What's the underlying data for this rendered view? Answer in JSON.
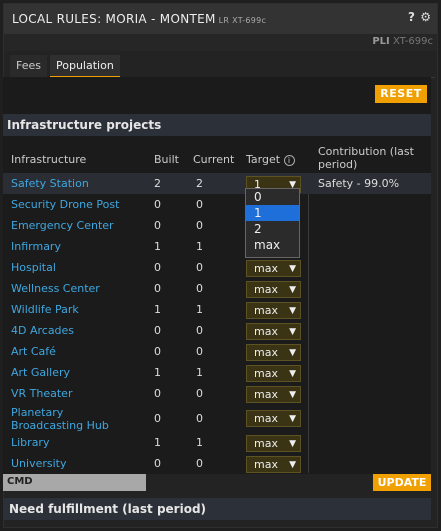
{
  "title": "LOCAL RULES: MORIA - MONTEM",
  "title_sub": "LR XT-699c",
  "context_prefix": "PLI",
  "context_code": "XT-699c",
  "tabs": [
    "Fees",
    "Population"
  ],
  "reset_label": "RESET",
  "section_title": "Infrastructure projects",
  "headers": {
    "infrastructure": "Infrastructure",
    "built": "Built",
    "current": "Current",
    "target": "Target",
    "contribution": "Contribution (last period)"
  },
  "rows": [
    {
      "name": "Safety Station",
      "built": "2",
      "current": "2",
      "target": "1",
      "contribution": "Safety - 99.0%"
    },
    {
      "name": "Security Drone Post",
      "built": "0",
      "current": "0",
      "target": "",
      "contribution": ""
    },
    {
      "name": "Emergency Center",
      "built": "0",
      "current": "0",
      "target": "",
      "contribution": ""
    },
    {
      "name": "Infirmary",
      "built": "1",
      "current": "1",
      "target": "",
      "contribution": ""
    },
    {
      "name": "Hospital",
      "built": "0",
      "current": "0",
      "target": "max",
      "contribution": ""
    },
    {
      "name": "Wellness Center",
      "built": "0",
      "current": "0",
      "target": "max",
      "contribution": ""
    },
    {
      "name": "Wildlife Park",
      "built": "1",
      "current": "1",
      "target": "max",
      "contribution": ""
    },
    {
      "name": "4D Arcades",
      "built": "0",
      "current": "0",
      "target": "max",
      "contribution": ""
    },
    {
      "name": "Art Café",
      "built": "0",
      "current": "0",
      "target": "max",
      "contribution": ""
    },
    {
      "name": "Art Gallery",
      "built": "1",
      "current": "1",
      "target": "max",
      "contribution": ""
    },
    {
      "name": "VR Theater",
      "built": "0",
      "current": "0",
      "target": "max",
      "contribution": ""
    },
    {
      "name": "Planetary Broadcasting Hub",
      "built": "0",
      "current": "0",
      "target": "max",
      "contribution": ""
    },
    {
      "name": "Library",
      "built": "1",
      "current": "1",
      "target": "max",
      "contribution": ""
    },
    {
      "name": "University",
      "built": "0",
      "current": "0",
      "target": "max",
      "contribution": ""
    }
  ],
  "dropdown_options": [
    "0",
    "1",
    "2",
    "max"
  ],
  "cmd_label": "CMD",
  "update_label": "UPDATE",
  "section2_title": "Need fulfillment (last period)",
  "colors": {
    "accent": "#f0a000",
    "link": "#3fa7e0",
    "selected": "#1e6fd9"
  }
}
